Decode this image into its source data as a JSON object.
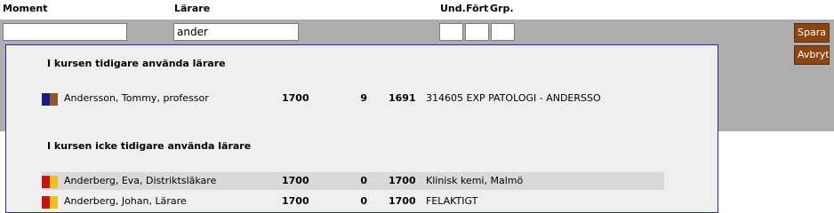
{
  "columns": {
    "moment": "Moment",
    "larare": "Lärare",
    "und": "Und.",
    "fort": "Fört",
    "grp": "Grp."
  },
  "fields": {
    "moment_value": "",
    "larare_value": "ander",
    "und_value": "",
    "fort_value": "",
    "grp_value": ""
  },
  "buttons": {
    "save": "Spara",
    "cancel": "Avbryt"
  },
  "popup": {
    "section_used": "I kursen tidigare använda lärare",
    "section_unused": "I kursen icke tidigare använda lärare",
    "used": [
      {
        "name": "Andersson, Tommy, professor",
        "v1": "1700",
        "v2": "9",
        "v3": "1691",
        "desc": "314605 EXP PATOLOGI - ANDERSSO",
        "flag": [
          "#1a1a8c",
          "#8b5a2b"
        ]
      }
    ],
    "unused": [
      {
        "name": "Anderberg, Eva, Distriktsläkare",
        "v1": "1700",
        "v2": "0",
        "v3": "1700",
        "desc": "Klinisk kemi, Malmö",
        "flag": [
          "#cc1111",
          "#f0c020"
        ]
      },
      {
        "name": "Anderberg, Johan, Lärare",
        "v1": "1700",
        "v2": "0",
        "v3": "1700",
        "desc": "FELAKTIGT",
        "flag": [
          "#cc1111",
          "#f0c020"
        ]
      }
    ]
  },
  "colors": {
    "band": "#adadad",
    "button": "#8b4513",
    "popup_border": "#2b2bb3",
    "highlight": "#d9d9d9"
  }
}
